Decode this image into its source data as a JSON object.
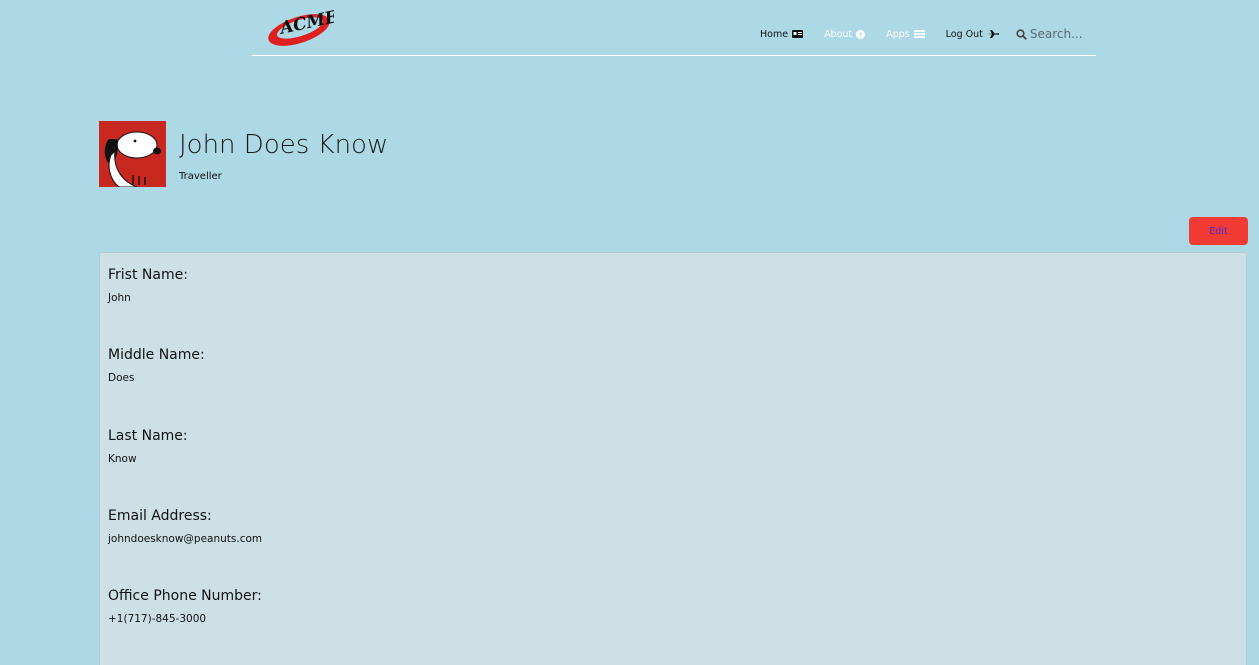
{
  "header": {
    "logo_text": "ACME",
    "nav": [
      {
        "label": "Home",
        "icon": "id-card-icon"
      },
      {
        "label": "About",
        "icon": "question-circle-icon"
      },
      {
        "label": "Apps",
        "icon": "list-icon"
      },
      {
        "label": "Log Out",
        "icon": "plane-icon"
      }
    ],
    "search": {
      "placeholder": "Search..."
    }
  },
  "profile": {
    "name": "John Does Know",
    "role": "Traveller",
    "avatar_icon": "snoopy-avatar"
  },
  "edit_label": "Edit",
  "fields": [
    {
      "label": "Frist Name:",
      "value": "John"
    },
    {
      "label": "Middle Name:",
      "value": "Does"
    },
    {
      "label": "Last Name:",
      "value": "Know"
    },
    {
      "label": "Email Address:",
      "value": "johndoesknow@peanuts.com"
    },
    {
      "label": "Office Phone Number:",
      "value": "+1(717)-845-3000"
    }
  ],
  "colors": {
    "background": "#add8e6",
    "panel": "#cde0e6",
    "edit_button": "#f23a35",
    "avatar_bg": "#c8281f"
  }
}
